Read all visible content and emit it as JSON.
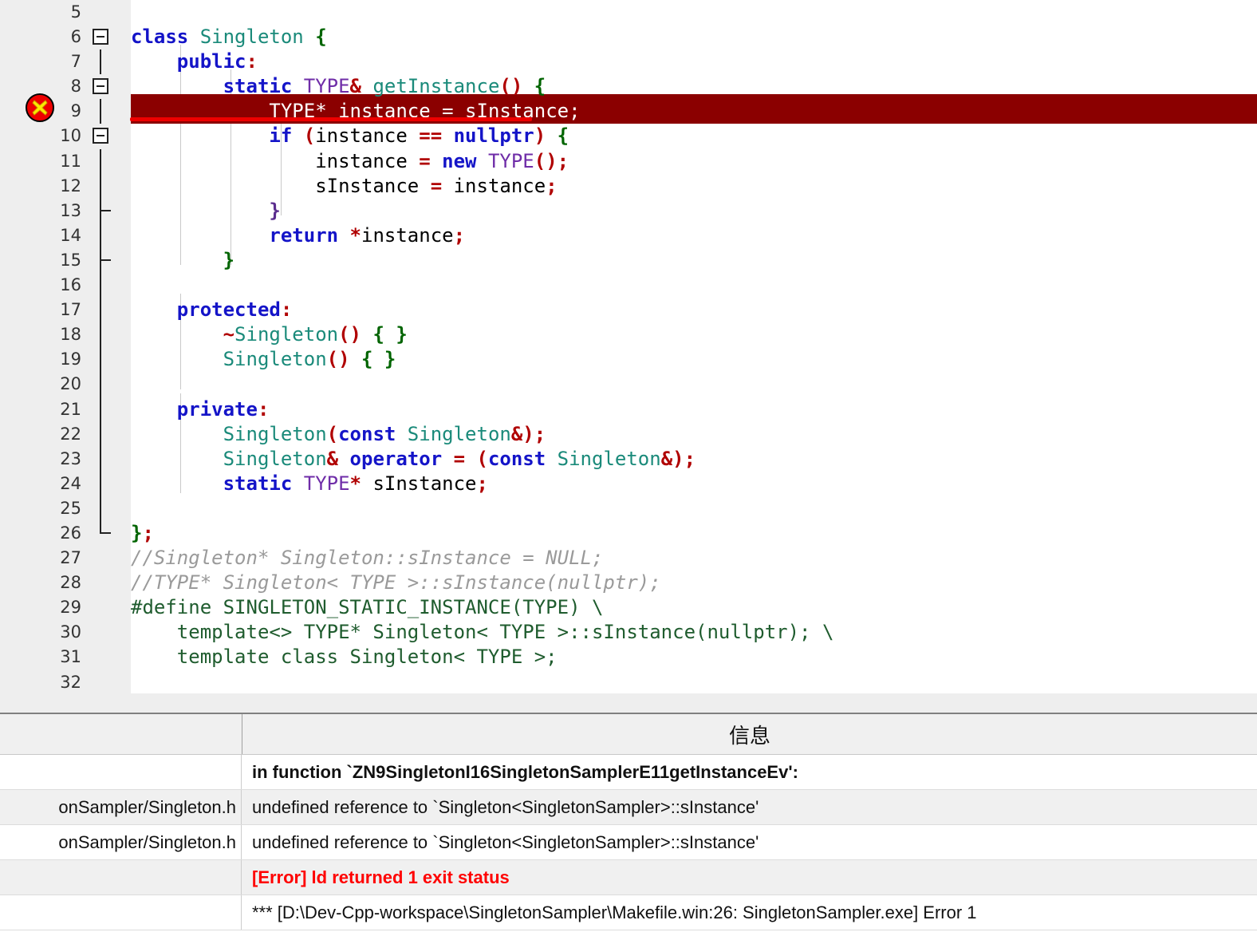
{
  "editor": {
    "first_visible_line": 5,
    "last_visible_line": 32,
    "error_line": 9,
    "error_marker_icon": "error-cross-circle-icon",
    "highlight_color": "#8b0000",
    "underline_color": "#ee0000",
    "line_numbers": [
      5,
      6,
      7,
      8,
      9,
      10,
      11,
      12,
      13,
      14,
      15,
      16,
      17,
      18,
      19,
      20,
      21,
      22,
      23,
      24,
      25,
      26,
      27,
      28,
      29,
      30,
      31,
      32
    ],
    "fold_markers": {
      "boxes": [
        6,
        8,
        10
      ],
      "ticks": [
        13,
        15
      ],
      "end": 26
    },
    "lines": [
      {
        "n": 5,
        "text": ""
      },
      {
        "n": 6,
        "text": "class Singleton {"
      },
      {
        "n": 7,
        "text": "    public:"
      },
      {
        "n": 8,
        "text": "        static TYPE& getInstance() {"
      },
      {
        "n": 9,
        "text": "            TYPE* instance = sInstance;"
      },
      {
        "n": 10,
        "text": "            if (instance == nullptr) {"
      },
      {
        "n": 11,
        "text": "                instance = new TYPE();"
      },
      {
        "n": 12,
        "text": "                sInstance = instance;"
      },
      {
        "n": 13,
        "text": "            }"
      },
      {
        "n": 14,
        "text": "            return *instance;"
      },
      {
        "n": 15,
        "text": "        }"
      },
      {
        "n": 16,
        "text": ""
      },
      {
        "n": 17,
        "text": "    protected:"
      },
      {
        "n": 18,
        "text": "        ~Singleton() { }"
      },
      {
        "n": 19,
        "text": "        Singleton() { }"
      },
      {
        "n": 20,
        "text": ""
      },
      {
        "n": 21,
        "text": "    private:"
      },
      {
        "n": 22,
        "text": "        Singleton(const Singleton&);"
      },
      {
        "n": 23,
        "text": "        Singleton& operator = (const Singleton&);"
      },
      {
        "n": 24,
        "text": "        static TYPE* sInstance;"
      },
      {
        "n": 25,
        "text": ""
      },
      {
        "n": 26,
        "text": "};"
      },
      {
        "n": 27,
        "text": "//Singleton* Singleton::sInstance = NULL;"
      },
      {
        "n": 28,
        "text": "//TYPE* Singleton< TYPE >::sInstance(nullptr);"
      },
      {
        "n": 29,
        "text": "#define SINGLETON_STATIC_INSTANCE(TYPE) \\"
      },
      {
        "n": 30,
        "text": "    template<> TYPE* Singleton< TYPE >::sInstance(nullptr); \\"
      },
      {
        "n": 31,
        "text": "    template class Singleton< TYPE >;"
      },
      {
        "n": 32,
        "text": ""
      }
    ]
  },
  "panel": {
    "columns": [
      "",
      "信息"
    ],
    "rows": [
      {
        "file": "",
        "message": "in function `ZN9SingletonI16SingletonSamplerE11getInstanceEv':",
        "style": "bold"
      },
      {
        "file": "onSampler/Singleton.h",
        "message": "undefined reference to `Singleton<SingletonSampler>::sInstance'",
        "style": "normal"
      },
      {
        "file": "onSampler/Singleton.h",
        "message": "undefined reference to `Singleton<SingletonSampler>::sInstance'",
        "style": "normal"
      },
      {
        "file": "",
        "message": "[Error] ld returned 1 exit status",
        "style": "error"
      },
      {
        "file": "",
        "message": "*** [D:\\Dev-Cpp-workspace\\SingletonSampler\\Makefile.win:26: SingletonSampler.exe] Error 1",
        "style": "normal"
      }
    ],
    "error_color": "#ff0000"
  }
}
